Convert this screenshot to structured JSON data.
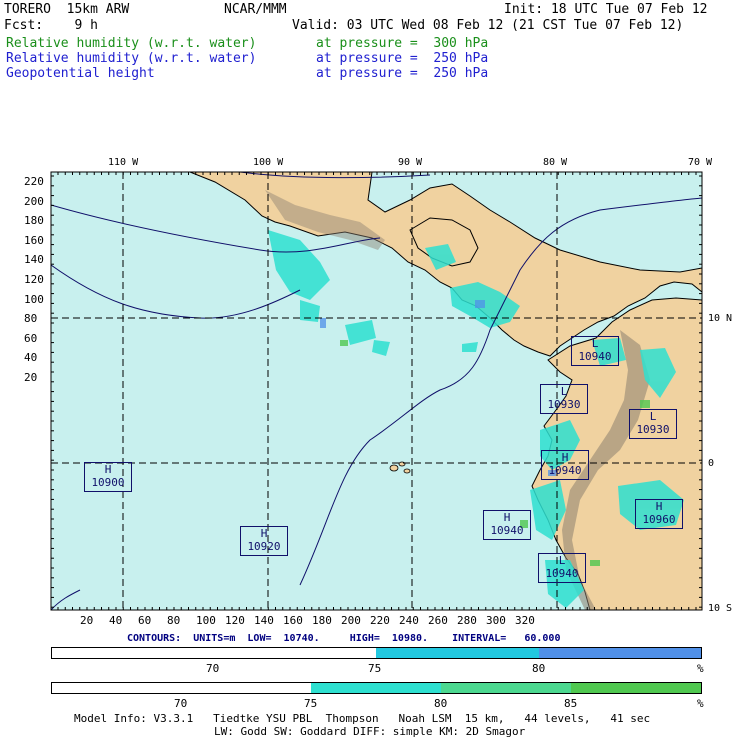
{
  "header": {
    "model_name": "TORERO  15km ARW",
    "org": "NCAR/MMM",
    "init": "Init: 18 UTC Tue 07 Feb 12",
    "fcst": "Fcst:    9 h",
    "valid": "Valid: 03 UTC Wed 08 Feb 12 (21 CST Tue 07 Feb 12)"
  },
  "fields": [
    {
      "name": "Relative humidity (w.r.t. water)",
      "level": "at pressure =  300 hPa",
      "color": "#1a8f1a"
    },
    {
      "name": "Relative humidity (w.r.t. water)",
      "level": "at pressure =  250 hPa",
      "color": "#2020d0"
    },
    {
      "name": "Geopotential height",
      "level": "at pressure =  250 hPa",
      "color": "#2020d0"
    }
  ],
  "map": {
    "lon_labels": [
      "110 W",
      "100 W",
      "90 W",
      "80 W",
      "70 W"
    ],
    "lat_labels": [
      "10 N",
      "0",
      "10 S"
    ],
    "y_ticks": [
      "220",
      "200",
      "180",
      "160",
      "140",
      "120",
      "100",
      "80",
      "60",
      "40",
      "20"
    ],
    "x_ticks": [
      "20",
      "40",
      "60",
      "80",
      "100",
      "120",
      "140",
      "160",
      "180",
      "200",
      "220",
      "240",
      "260",
      "280",
      "300",
      "320"
    ],
    "ocean_color": "#c8f0ee",
    "land_color": "#f0d2a0",
    "centers": [
      {
        "type": "H",
        "value": "10900"
      },
      {
        "type": "H",
        "value": "10920"
      },
      {
        "type": "H",
        "value": "10940"
      },
      {
        "type": "L",
        "value": "10930"
      },
      {
        "type": "L",
        "value": "10940"
      },
      {
        "type": "H",
        "value": "10940"
      },
      {
        "type": "L",
        "value": "10930"
      },
      {
        "type": "H",
        "value": "10960"
      },
      {
        "type": "L",
        "value": "10940"
      }
    ]
  },
  "contours_text": "CONTOURS:  UNITS=m  LOW=  10740.     HIGH=  10980.    INTERVAL=   60.000",
  "colorbar1": {
    "labels": [
      "70",
      "75",
      "80",
      "%"
    ],
    "colors": [
      "#ffffff",
      "#22c8e0",
      "#5090e8"
    ]
  },
  "colorbar2": {
    "labels": [
      "70",
      "75",
      "80",
      "85",
      "%"
    ],
    "colors": [
      "#ffffff",
      "#2ee0d0",
      "#4cd890",
      "#50c850"
    ]
  },
  "model_info": {
    "line1": "Model Info: V3.3.1   Tiedtke YSU PBL  Thompson   Noah LSM  15 km,   44 levels,   41 sec",
    "line2": "LW: Godd SW: Goddard DIFF: simple KM: 2D Smagor"
  }
}
